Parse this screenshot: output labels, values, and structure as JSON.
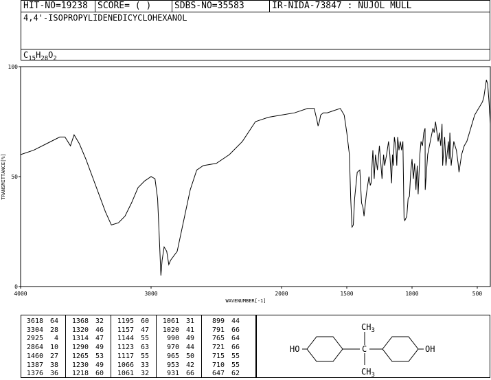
{
  "header": {
    "hit_no": "HIT-NO=19238",
    "score": "SCORE=  (  )",
    "sdbs_no": "SDBS-NO=35583",
    "ir_info": "IR-NIDA-73847 : NUJOL MULL",
    "compound_name": "4,4'-ISOPROPYLIDENEDICYCLOHEXANOL",
    "formula": {
      "c": "C",
      "c_n": "15",
      "h": "H",
      "h_n": "28",
      "o": "O",
      "o_n": "2"
    }
  },
  "chart_data": {
    "type": "line",
    "xlabel": "WAVENUMBER[-1]",
    "ylabel": "TRANSMITTANCE[%]",
    "xlim": [
      4000,
      400
    ],
    "ylim": [
      0,
      100
    ],
    "x_ticks": [
      "4000",
      "3000",
      "2000",
      "1500",
      "1000",
      "500"
    ],
    "y_ticks": [
      "0",
      "50",
      "100"
    ],
    "x_tick_values": [
      4000,
      3000,
      2000,
      1500,
      1000,
      500
    ],
    "y_tick_values": [
      0,
      50,
      100
    ],
    "series": [
      {
        "x": [
          4000,
          3900,
          3800,
          3700,
          3660,
          3618,
          3590,
          3550,
          3500,
          3450,
          3400,
          3350,
          3304,
          3250,
          3200,
          3150,
          3100,
          3050,
          3000,
          2970,
          2950,
          2935,
          2925,
          2915,
          2900,
          2880,
          2864,
          2850,
          2800,
          2750,
          2700,
          2650,
          2600,
          2500,
          2400,
          2300,
          2200,
          2100,
          2000,
          1900,
          1800,
          1750,
          1730,
          1720,
          1710,
          1700,
          1680,
          1650,
          1600,
          1550,
          1520,
          1500,
          1480,
          1470,
          1460,
          1450,
          1440,
          1420,
          1400,
          1387,
          1376,
          1368,
          1350,
          1330,
          1320,
          1314,
          1300,
          1290,
          1280,
          1265,
          1250,
          1230,
          1218,
          1210,
          1195,
          1180,
          1170,
          1157,
          1150,
          1144,
          1135,
          1123,
          1117,
          1110,
          1100,
          1090,
          1080,
          1070,
          1061,
          1055,
          1040,
          1030,
          1020,
          1010,
          1000,
          990,
          980,
          970,
          965,
          960,
          953,
          940,
          931,
          920,
          910,
          900,
          899,
          880,
          860,
          840,
          830,
          820,
          800,
          791,
          780,
          770,
          765,
          750,
          740,
          721,
          715,
          710,
          700,
          680,
          660,
          647,
          640,
          620,
          600,
          580,
          560,
          540,
          520,
          500,
          480,
          460,
          450,
          440,
          430,
          420,
          410,
          400
        ],
        "y": [
          60,
          62,
          65,
          68,
          68,
          64,
          69,
          65,
          58,
          50,
          42,
          34,
          28,
          29,
          32,
          38,
          45,
          48,
          50,
          49,
          40,
          20,
          5,
          12,
          18,
          16,
          10,
          12,
          16,
          30,
          44,
          53,
          55,
          56,
          60,
          66,
          75,
          77,
          78,
          79,
          81,
          81,
          76,
          73,
          75,
          78,
          79,
          79,
          80,
          81,
          78,
          70,
          60,
          40,
          27,
          28,
          40,
          52,
          53,
          38,
          36,
          32,
          42,
          50,
          46,
          47,
          62,
          49,
          60,
          53,
          64,
          49,
          60,
          55,
          60,
          66,
          60,
          47,
          60,
          55,
          68,
          63,
          55,
          68,
          62,
          66,
          62,
          66,
          31,
          30,
          32,
          40,
          41,
          52,
          58,
          49,
          56,
          44,
          50,
          55,
          42,
          60,
          66,
          64,
          70,
          72,
          44,
          60,
          66,
          72,
          70,
          75,
          66,
          70,
          64,
          74,
          55,
          68,
          55,
          66,
          58,
          70,
          55,
          66,
          62,
          56,
          52,
          60,
          64,
          66,
          70,
          74,
          78,
          80,
          82,
          84,
          86,
          90,
          94,
          92,
          84,
          74
        ]
      }
    ]
  },
  "peak_table": [
    [
      [
        "3618",
        "64"
      ],
      [
        "3304",
        "28"
      ],
      [
        "2925",
        "4"
      ],
      [
        "2864",
        "10"
      ],
      [
        "1460",
        "27"
      ],
      [
        "1387",
        "38"
      ],
      [
        "1376",
        "36"
      ]
    ],
    [
      [
        "1368",
        "32"
      ],
      [
        "1320",
        "46"
      ],
      [
        "1314",
        "47"
      ],
      [
        "1290",
        "49"
      ],
      [
        "1265",
        "53"
      ],
      [
        "1230",
        "49"
      ],
      [
        "1218",
        "60"
      ]
    ],
    [
      [
        "1195",
        "60"
      ],
      [
        "1157",
        "47"
      ],
      [
        "1144",
        "55"
      ],
      [
        "1123",
        "63"
      ],
      [
        "1117",
        "55"
      ],
      [
        "1066",
        "33"
      ],
      [
        "1061",
        "32"
      ]
    ],
    [
      [
        "1061",
        "31"
      ],
      [
        "1020",
        "41"
      ],
      [
        "990",
        "49"
      ],
      [
        "970",
        "44"
      ],
      [
        "965",
        "50"
      ],
      [
        "953",
        "42"
      ],
      [
        "931",
        "66"
      ]
    ],
    [
      [
        "899",
        "44"
      ],
      [
        "791",
        "66"
      ],
      [
        "765",
        "64"
      ],
      [
        "721",
        "66"
      ],
      [
        "715",
        "55"
      ],
      [
        "710",
        "55"
      ],
      [
        "647",
        "62"
      ]
    ]
  ],
  "structure": {
    "left_group": "HO",
    "right_group": "OH",
    "top_group": "CH3",
    "bottom_group": "CH3",
    "top_label": {
      "base": "CH",
      "sub": "3"
    },
    "bottom_label": {
      "base": "CH",
      "sub": "3"
    }
  }
}
